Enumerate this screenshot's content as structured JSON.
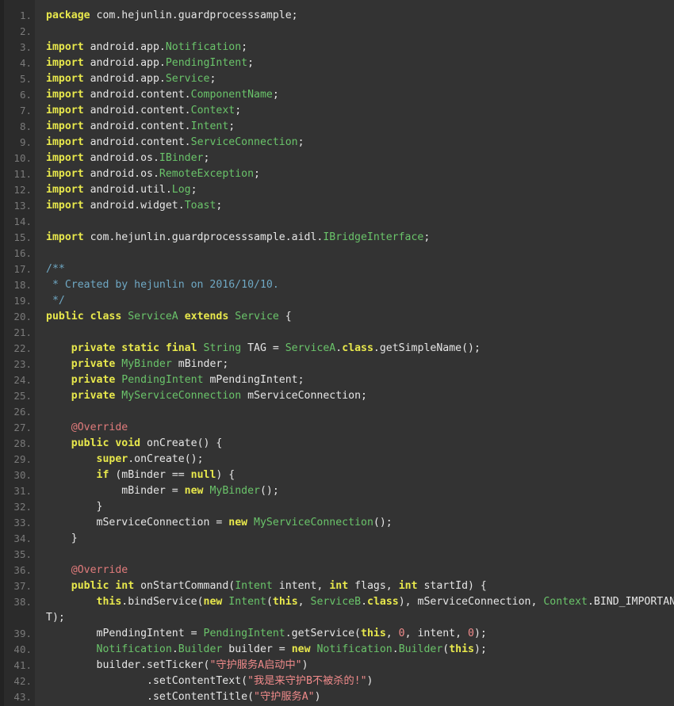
{
  "editor": {
    "language": "Java",
    "theme_name": "dark",
    "colors": {
      "background": "#333333",
      "gutter_background": "#2b2b2b",
      "rail": "#232323",
      "line_number": "#7a7a7a",
      "keyword": "#e8e84c",
      "type": "#6ac46a",
      "plain_text": "#e6e6e6",
      "comment": "#6fa8c4",
      "string": "#ef8a8a",
      "number": "#ef8a8a",
      "annotation": "#e07b7b"
    },
    "first_line_number": 1,
    "last_line_number": 43,
    "total_visible_rows": 44
  },
  "lines": [
    {
      "n": "1.",
      "tokens": [
        {
          "t": "package",
          "c": "kw"
        },
        {
          "t": " com.hejunlin.guardprocesssample;",
          "c": "plain"
        }
      ]
    },
    {
      "n": "2.",
      "tokens": []
    },
    {
      "n": "3.",
      "tokens": [
        {
          "t": "import",
          "c": "kw"
        },
        {
          "t": " android.app.",
          "c": "plain"
        },
        {
          "t": "Notification",
          "c": "type"
        },
        {
          "t": ";",
          "c": "plain"
        }
      ]
    },
    {
      "n": "4.",
      "tokens": [
        {
          "t": "import",
          "c": "kw"
        },
        {
          "t": " android.app.",
          "c": "plain"
        },
        {
          "t": "PendingIntent",
          "c": "type"
        },
        {
          "t": ";",
          "c": "plain"
        }
      ]
    },
    {
      "n": "5.",
      "tokens": [
        {
          "t": "import",
          "c": "kw"
        },
        {
          "t": " android.app.",
          "c": "plain"
        },
        {
          "t": "Service",
          "c": "type"
        },
        {
          "t": ";",
          "c": "plain"
        }
      ]
    },
    {
      "n": "6.",
      "tokens": [
        {
          "t": "import",
          "c": "kw"
        },
        {
          "t": " android.content.",
          "c": "plain"
        },
        {
          "t": "ComponentName",
          "c": "type"
        },
        {
          "t": ";",
          "c": "plain"
        }
      ]
    },
    {
      "n": "7.",
      "tokens": [
        {
          "t": "import",
          "c": "kw"
        },
        {
          "t": " android.content.",
          "c": "plain"
        },
        {
          "t": "Context",
          "c": "type"
        },
        {
          "t": ";",
          "c": "plain"
        }
      ]
    },
    {
      "n": "8.",
      "tokens": [
        {
          "t": "import",
          "c": "kw"
        },
        {
          "t": " android.content.",
          "c": "plain"
        },
        {
          "t": "Intent",
          "c": "type"
        },
        {
          "t": ";",
          "c": "plain"
        }
      ]
    },
    {
      "n": "9.",
      "tokens": [
        {
          "t": "import",
          "c": "kw"
        },
        {
          "t": " android.content.",
          "c": "plain"
        },
        {
          "t": "ServiceConnection",
          "c": "type"
        },
        {
          "t": ";",
          "c": "plain"
        }
      ]
    },
    {
      "n": "10.",
      "tokens": [
        {
          "t": "import",
          "c": "kw"
        },
        {
          "t": " android.os.",
          "c": "plain"
        },
        {
          "t": "IBinder",
          "c": "type"
        },
        {
          "t": ";",
          "c": "plain"
        }
      ]
    },
    {
      "n": "11.",
      "tokens": [
        {
          "t": "import",
          "c": "kw"
        },
        {
          "t": " android.os.",
          "c": "plain"
        },
        {
          "t": "RemoteException",
          "c": "type"
        },
        {
          "t": ";",
          "c": "plain"
        }
      ]
    },
    {
      "n": "12.",
      "tokens": [
        {
          "t": "import",
          "c": "kw"
        },
        {
          "t": " android.util.",
          "c": "plain"
        },
        {
          "t": "Log",
          "c": "type"
        },
        {
          "t": ";",
          "c": "plain"
        }
      ]
    },
    {
      "n": "13.",
      "tokens": [
        {
          "t": "import",
          "c": "kw"
        },
        {
          "t": " android.widget.",
          "c": "plain"
        },
        {
          "t": "Toast",
          "c": "type"
        },
        {
          "t": ";",
          "c": "plain"
        }
      ]
    },
    {
      "n": "14.",
      "tokens": []
    },
    {
      "n": "15.",
      "tokens": [
        {
          "t": "import",
          "c": "kw"
        },
        {
          "t": " com.hejunlin.guardprocesssample.aidl.",
          "c": "plain"
        },
        {
          "t": "IBridgeInterface",
          "c": "type"
        },
        {
          "t": ";",
          "c": "plain"
        }
      ]
    },
    {
      "n": "16.",
      "tokens": []
    },
    {
      "n": "17.",
      "tokens": [
        {
          "t": "/**",
          "c": "cmt"
        }
      ]
    },
    {
      "n": "18.",
      "tokens": [
        {
          "t": " * Created by hejunlin on 2016/10/10.",
          "c": "cmt"
        }
      ]
    },
    {
      "n": "19.",
      "tokens": [
        {
          "t": " */",
          "c": "cmt"
        }
      ]
    },
    {
      "n": "20.",
      "tokens": [
        {
          "t": "public class",
          "c": "kw"
        },
        {
          "t": " ",
          "c": "plain"
        },
        {
          "t": "ServiceA",
          "c": "type"
        },
        {
          "t": " ",
          "c": "plain"
        },
        {
          "t": "extends",
          "c": "kw"
        },
        {
          "t": " ",
          "c": "plain"
        },
        {
          "t": "Service",
          "c": "type"
        },
        {
          "t": " {",
          "c": "plain"
        }
      ]
    },
    {
      "n": "21.",
      "tokens": []
    },
    {
      "n": "22.",
      "tokens": [
        {
          "t": "    ",
          "c": "plain"
        },
        {
          "t": "private static final",
          "c": "kw"
        },
        {
          "t": " ",
          "c": "plain"
        },
        {
          "t": "String",
          "c": "type"
        },
        {
          "t": " TAG = ",
          "c": "plain"
        },
        {
          "t": "ServiceA",
          "c": "type"
        },
        {
          "t": ".",
          "c": "plain"
        },
        {
          "t": "class",
          "c": "kw"
        },
        {
          "t": ".getSimpleName();",
          "c": "plain"
        }
      ]
    },
    {
      "n": "23.",
      "tokens": [
        {
          "t": "    ",
          "c": "plain"
        },
        {
          "t": "private",
          "c": "kw"
        },
        {
          "t": " ",
          "c": "plain"
        },
        {
          "t": "MyBinder",
          "c": "type"
        },
        {
          "t": " mBinder;",
          "c": "plain"
        }
      ]
    },
    {
      "n": "24.",
      "tokens": [
        {
          "t": "    ",
          "c": "plain"
        },
        {
          "t": "private",
          "c": "kw"
        },
        {
          "t": " ",
          "c": "plain"
        },
        {
          "t": "PendingIntent",
          "c": "type"
        },
        {
          "t": " mPendingIntent;",
          "c": "plain"
        }
      ]
    },
    {
      "n": "25.",
      "tokens": [
        {
          "t": "    ",
          "c": "plain"
        },
        {
          "t": "private",
          "c": "kw"
        },
        {
          "t": " ",
          "c": "plain"
        },
        {
          "t": "MyServiceConnection",
          "c": "type"
        },
        {
          "t": " mServiceConnection;",
          "c": "plain"
        }
      ]
    },
    {
      "n": "26.",
      "tokens": []
    },
    {
      "n": "27.",
      "tokens": [
        {
          "t": "    ",
          "c": "plain"
        },
        {
          "t": "@Override",
          "c": "ann"
        }
      ]
    },
    {
      "n": "28.",
      "tokens": [
        {
          "t": "    ",
          "c": "plain"
        },
        {
          "t": "public void",
          "c": "kw"
        },
        {
          "t": " onCreate() {",
          "c": "plain"
        }
      ]
    },
    {
      "n": "29.",
      "tokens": [
        {
          "t": "        ",
          "c": "plain"
        },
        {
          "t": "super",
          "c": "kw"
        },
        {
          "t": ".onCreate();",
          "c": "plain"
        }
      ]
    },
    {
      "n": "30.",
      "tokens": [
        {
          "t": "        ",
          "c": "plain"
        },
        {
          "t": "if",
          "c": "kw"
        },
        {
          "t": " (mBinder == ",
          "c": "plain"
        },
        {
          "t": "null",
          "c": "kw"
        },
        {
          "t": ") {",
          "c": "plain"
        }
      ]
    },
    {
      "n": "31.",
      "tokens": [
        {
          "t": "            mBinder = ",
          "c": "plain"
        },
        {
          "t": "new",
          "c": "kw"
        },
        {
          "t": " ",
          "c": "plain"
        },
        {
          "t": "MyBinder",
          "c": "type"
        },
        {
          "t": "();",
          "c": "plain"
        }
      ]
    },
    {
      "n": "32.",
      "tokens": [
        {
          "t": "        }",
          "c": "plain"
        }
      ]
    },
    {
      "n": "33.",
      "tokens": [
        {
          "t": "        mServiceConnection = ",
          "c": "plain"
        },
        {
          "t": "new",
          "c": "kw"
        },
        {
          "t": " ",
          "c": "plain"
        },
        {
          "t": "MyServiceConnection",
          "c": "type"
        },
        {
          "t": "();",
          "c": "plain"
        }
      ]
    },
    {
      "n": "34.",
      "tokens": [
        {
          "t": "    }",
          "c": "plain"
        }
      ]
    },
    {
      "n": "35.",
      "tokens": []
    },
    {
      "n": "36.",
      "tokens": [
        {
          "t": "    ",
          "c": "plain"
        },
        {
          "t": "@Override",
          "c": "ann"
        }
      ]
    },
    {
      "n": "37.",
      "tokens": [
        {
          "t": "    ",
          "c": "plain"
        },
        {
          "t": "public int",
          "c": "kw"
        },
        {
          "t": " onStartCommand(",
          "c": "plain"
        },
        {
          "t": "Intent",
          "c": "type"
        },
        {
          "t": " intent, ",
          "c": "plain"
        },
        {
          "t": "int",
          "c": "kw"
        },
        {
          "t": " flags, ",
          "c": "plain"
        },
        {
          "t": "int",
          "c": "kw"
        },
        {
          "t": " startId) {",
          "c": "plain"
        }
      ]
    },
    {
      "n": "38.",
      "tokens": [
        {
          "t": "        ",
          "c": "plain"
        },
        {
          "t": "this",
          "c": "kw"
        },
        {
          "t": ".bindService(",
          "c": "plain"
        },
        {
          "t": "new",
          "c": "kw"
        },
        {
          "t": " ",
          "c": "plain"
        },
        {
          "t": "Intent",
          "c": "type"
        },
        {
          "t": "(",
          "c": "plain"
        },
        {
          "t": "this",
          "c": "kw"
        },
        {
          "t": ", ",
          "c": "plain"
        },
        {
          "t": "ServiceB",
          "c": "type"
        },
        {
          "t": ".",
          "c": "plain"
        },
        {
          "t": "class",
          "c": "kw"
        },
        {
          "t": "), mServiceConnection, ",
          "c": "plain"
        },
        {
          "t": "Context",
          "c": "type"
        },
        {
          "t": ".BIND_IMPORTAN",
          "c": "plain"
        }
      ]
    },
    {
      "n": "",
      "wrapped": true,
      "tokens": [
        {
          "t": "T);",
          "c": "plain"
        }
      ]
    },
    {
      "n": "39.",
      "tokens": [
        {
          "t": "        mPendingIntent = ",
          "c": "plain"
        },
        {
          "t": "PendingIntent",
          "c": "type"
        },
        {
          "t": ".getService(",
          "c": "plain"
        },
        {
          "t": "this",
          "c": "kw"
        },
        {
          "t": ", ",
          "c": "plain"
        },
        {
          "t": "0",
          "c": "num"
        },
        {
          "t": ", intent, ",
          "c": "plain"
        },
        {
          "t": "0",
          "c": "num"
        },
        {
          "t": ");",
          "c": "plain"
        }
      ]
    },
    {
      "n": "40.",
      "tokens": [
        {
          "t": "        ",
          "c": "plain"
        },
        {
          "t": "Notification",
          "c": "type"
        },
        {
          "t": ".",
          "c": "plain"
        },
        {
          "t": "Builder",
          "c": "type"
        },
        {
          "t": " builder = ",
          "c": "plain"
        },
        {
          "t": "new",
          "c": "kw"
        },
        {
          "t": " ",
          "c": "plain"
        },
        {
          "t": "Notification",
          "c": "type"
        },
        {
          "t": ".",
          "c": "plain"
        },
        {
          "t": "Builder",
          "c": "type"
        },
        {
          "t": "(",
          "c": "plain"
        },
        {
          "t": "this",
          "c": "kw"
        },
        {
          "t": ");",
          "c": "plain"
        }
      ]
    },
    {
      "n": "41.",
      "tokens": [
        {
          "t": "        builder.setTicker(",
          "c": "plain"
        },
        {
          "t": "\"守护服务A启动中\"",
          "c": "str"
        },
        {
          "t": ")",
          "c": "plain"
        }
      ]
    },
    {
      "n": "42.",
      "tokens": [
        {
          "t": "                .setContentText(",
          "c": "plain"
        },
        {
          "t": "\"我是来守护B不被杀的!\"",
          "c": "str"
        },
        {
          "t": ")",
          "c": "plain"
        }
      ]
    },
    {
      "n": "43.",
      "tokens": [
        {
          "t": "                .setContentTitle(",
          "c": "plain"
        },
        {
          "t": "\"守护服务A\"",
          "c": "str"
        },
        {
          "t": ")",
          "c": "plain"
        }
      ]
    }
  ],
  "source_text": {
    "package_statement": "package com.hejunlin.guardprocesssample;",
    "class_declaration": "public class ServiceA extends Service {",
    "javadoc": "/**\n * Created by hejunlin on 2016/10/10.\n */",
    "strings": [
      "守护服务A启动中",
      "我是来守护B不被杀的!",
      "守护服务A"
    ]
  }
}
